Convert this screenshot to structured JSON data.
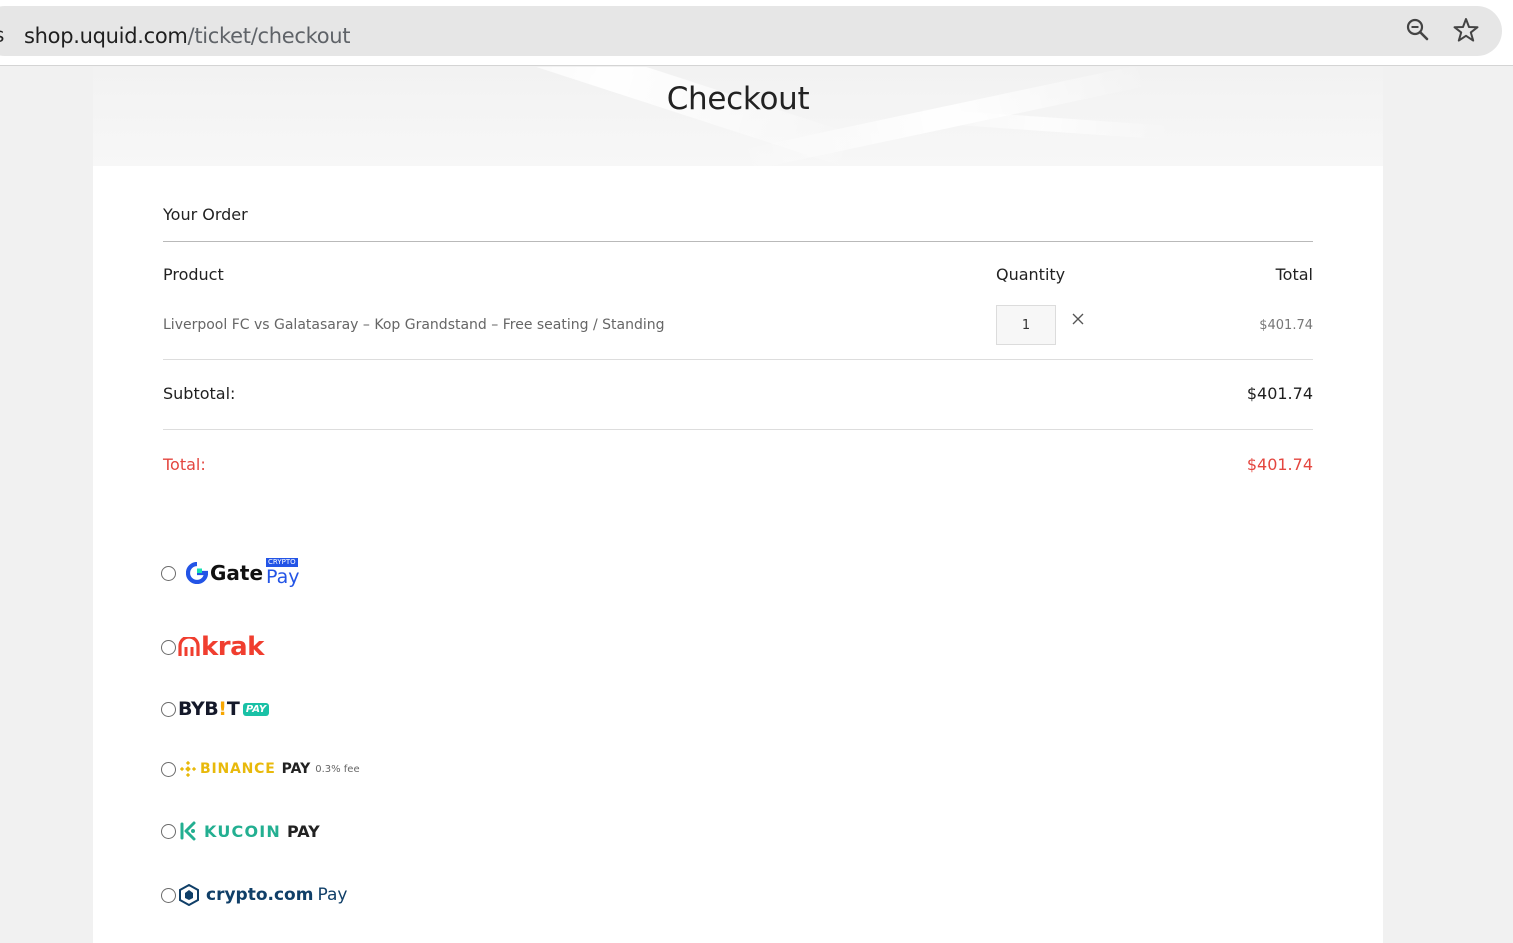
{
  "browser": {
    "url_host": "shop.uquid.com",
    "url_path": "/ticket/checkout"
  },
  "page": {
    "title": "Checkout"
  },
  "order": {
    "heading": "Your Order",
    "columns": {
      "product": "Product",
      "quantity": "Quantity",
      "total": "Total"
    },
    "items": [
      {
        "name": "Liverpool FC vs Galatasaray – Kop Grandstand – Free seating / Standing",
        "quantity": "1",
        "total": "$401.74"
      }
    ],
    "subtotal_label": "Subtotal:",
    "subtotal_value": "$401.74",
    "total_label": "Total:",
    "total_value": "$401.74"
  },
  "payment_methods": [
    {
      "id": "gate",
      "brand": "Gate",
      "suffix": "Pay",
      "badge": "CRYPTO",
      "icon": "gate-logo-icon",
      "color": "#2354e6"
    },
    {
      "id": "krak",
      "brand": "krak",
      "icon": "krak-logo-icon",
      "color": "#f03e2f"
    },
    {
      "id": "bybit",
      "brand": "BYB",
      "brand_accent": "!",
      "brand_tail": "T",
      "suffix": "PAY",
      "icon": "bybit-logo-icon",
      "color": "#15192a",
      "accent": "#f7a600",
      "suffix_color": "#19c1a6"
    },
    {
      "id": "binance",
      "brand": "BINANCE",
      "suffix": "PAY",
      "note": "0.3% fee",
      "icon": "binance-logo-icon",
      "color": "#e8b90b"
    },
    {
      "id": "kucoin",
      "brand": "KUCOIN",
      "suffix": "PAY",
      "icon": "kucoin-logo-icon",
      "color": "#23af91"
    },
    {
      "id": "cryptocom",
      "brand": "crypto.com",
      "suffix": "Pay",
      "icon": "cryptocom-logo-icon",
      "color": "#103f68"
    }
  ],
  "colors": {
    "accent_red": "#e4463f",
    "text_dark": "#222222"
  }
}
